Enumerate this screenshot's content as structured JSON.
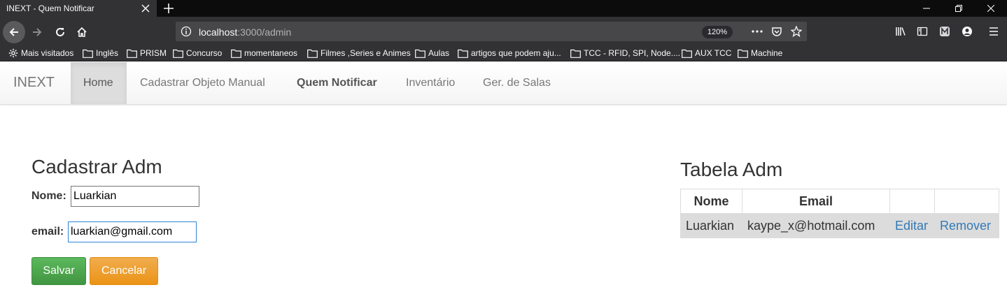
{
  "browser": {
    "tab_title": "INEXT - Quem Notificar",
    "url_host": "localhost",
    "url_path": ":3000/admin",
    "zoom": "120%",
    "bookmarks": [
      {
        "label": "Mais visitados",
        "icon": "gear-icon"
      },
      {
        "label": "Inglês",
        "icon": "folder-icon"
      },
      {
        "label": "PRISM",
        "icon": "folder-icon"
      },
      {
        "label": "Concurso",
        "icon": "folder-icon"
      },
      {
        "label": "momentaneos",
        "icon": "folder-icon"
      },
      {
        "label": "Filmes ,Series e Animes",
        "icon": "folder-icon"
      },
      {
        "label": "Aulas",
        "icon": "folder-icon"
      },
      {
        "label": "artigos que podem aju...",
        "icon": "folder-icon"
      },
      {
        "label": "TCC - RFID, SPI, Node....",
        "icon": "folder-icon"
      },
      {
        "label": "AUX TCC",
        "icon": "folder-icon"
      },
      {
        "label": "Machine",
        "icon": "folder-icon"
      }
    ]
  },
  "navbar": {
    "brand": "INEXT",
    "items": [
      {
        "label": "Home"
      },
      {
        "label": "Cadastrar Objeto Manual"
      },
      {
        "label": "Quem Notificar"
      },
      {
        "label": "Inventário"
      },
      {
        "label": "Ger. de Salas"
      }
    ]
  },
  "form": {
    "title": "Cadastrar Adm",
    "name_label": "Nome:",
    "name_value": "Luarkian",
    "email_label": "email:",
    "email_value": "luarkian@gmail.com",
    "save_label": "Salvar",
    "cancel_label": "Cancelar"
  },
  "table": {
    "title": "Tabela Adm",
    "headers": [
      "Nome",
      "Email",
      "",
      ""
    ],
    "rows": [
      {
        "nome": "Luarkian",
        "email": "kaype_x@hotmail.com",
        "edit": "Editar",
        "remove": "Remover"
      }
    ]
  },
  "colors": {
    "primary_link": "#337ab7",
    "save_button": "#5cb85c",
    "cancel_button": "#f0ad4e"
  }
}
